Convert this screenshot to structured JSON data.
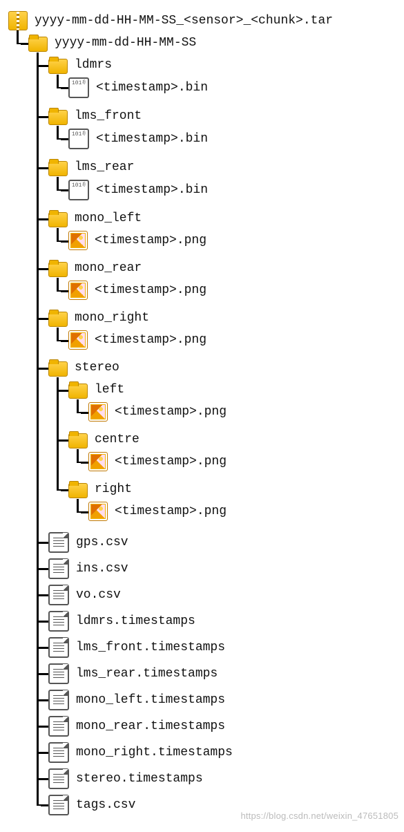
{
  "watermark": "https://blog.csdn.net/weixin_47651805",
  "tree": {
    "label": "yyyy-mm-dd-HH-MM-SS_<sensor>_<chunk>.tar",
    "icon": "archive",
    "children": [
      {
        "label": "yyyy-mm-dd-HH-MM-SS",
        "icon": "folder",
        "children": [
          {
            "label": "ldmrs",
            "icon": "folder",
            "children": [
              {
                "label": "<timestamp>.bin",
                "icon": "binfile"
              }
            ]
          },
          {
            "label": "lms_front",
            "icon": "folder",
            "children": [
              {
                "label": "<timestamp>.bin",
                "icon": "binfile"
              }
            ]
          },
          {
            "label": "lms_rear",
            "icon": "folder",
            "children": [
              {
                "label": "<timestamp>.bin",
                "icon": "binfile"
              }
            ]
          },
          {
            "label": "mono_left",
            "icon": "folder",
            "children": [
              {
                "label": "<timestamp>.png",
                "icon": "imgfile"
              }
            ]
          },
          {
            "label": "mono_rear",
            "icon": "folder",
            "children": [
              {
                "label": "<timestamp>.png",
                "icon": "imgfile"
              }
            ]
          },
          {
            "label": "mono_right",
            "icon": "folder",
            "children": [
              {
                "label": "<timestamp>.png",
                "icon": "imgfile"
              }
            ]
          },
          {
            "label": "stereo",
            "icon": "folder",
            "children": [
              {
                "label": "left",
                "icon": "folder",
                "children": [
                  {
                    "label": "<timestamp>.png",
                    "icon": "imgfile"
                  }
                ]
              },
              {
                "label": "centre",
                "icon": "folder",
                "children": [
                  {
                    "label": "<timestamp>.png",
                    "icon": "imgfile"
                  }
                ]
              },
              {
                "label": "right",
                "icon": "folder",
                "children": [
                  {
                    "label": "<timestamp>.png",
                    "icon": "imgfile"
                  }
                ]
              }
            ]
          },
          {
            "label": "gps.csv",
            "icon": "txtfile"
          },
          {
            "label": "ins.csv",
            "icon": "txtfile"
          },
          {
            "label": "vo.csv",
            "icon": "txtfile"
          },
          {
            "label": "ldmrs.timestamps",
            "icon": "txtfile"
          },
          {
            "label": "lms_front.timestamps",
            "icon": "txtfile"
          },
          {
            "label": "lms_rear.timestamps",
            "icon": "txtfile"
          },
          {
            "label": "mono_left.timestamps",
            "icon": "txtfile"
          },
          {
            "label": "mono_rear.timestamps",
            "icon": "txtfile"
          },
          {
            "label": "mono_right.timestamps",
            "icon": "txtfile"
          },
          {
            "label": "stereo.timestamps",
            "icon": "txtfile"
          },
          {
            "label": "tags.csv",
            "icon": "txtfile"
          }
        ]
      }
    ]
  }
}
